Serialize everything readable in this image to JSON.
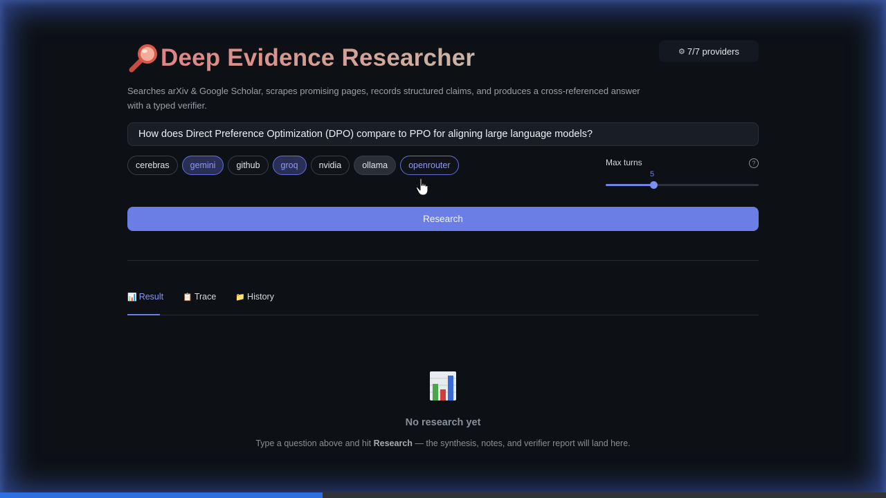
{
  "header": {
    "title": "Deep Evidence Researcher",
    "providers_badge": "7/7 providers",
    "description": "Searches arXiv & Google Scholar, scrapes promising pages, records structured claims, and produces a cross-referenced answer with a typed verifier."
  },
  "query": {
    "value": "How does Direct Preference Optimization (DPO) compare to PPO for aligning large language models?"
  },
  "providers": [
    {
      "label": "cerebras",
      "state": "default"
    },
    {
      "label": "gemini",
      "state": "selected"
    },
    {
      "label": "github",
      "state": "default"
    },
    {
      "label": "groq",
      "state": "selected"
    },
    {
      "label": "nvidia",
      "state": "default"
    },
    {
      "label": "ollama",
      "state": "hover"
    },
    {
      "label": "openrouter",
      "state": "outlined"
    }
  ],
  "max_turns": {
    "label": "Max turns",
    "value": "5",
    "fraction": 0.31
  },
  "actions": {
    "research_label": "Research"
  },
  "tabs": [
    {
      "label": "Result",
      "icon": "bar-chart-icon",
      "active": true
    },
    {
      "label": "Trace",
      "icon": "notepad-icon",
      "active": false
    },
    {
      "label": "History",
      "icon": "folder-icon",
      "active": false
    }
  ],
  "empty_state": {
    "title": "No research yet",
    "desc_before": "Type a question above and hit ",
    "desc_bold": "Research",
    "desc_after": " — the synthesis, notes, and verifier report will land here."
  },
  "video_progress": 0.364,
  "colors": {
    "accent": "#6a7ee6",
    "background": "#0d1015",
    "title_gradient_start": "#e08484"
  }
}
